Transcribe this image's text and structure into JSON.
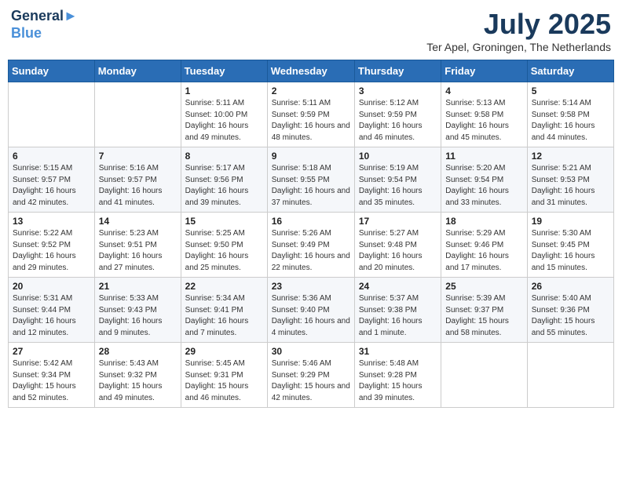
{
  "header": {
    "logo_line1": "General",
    "logo_line2": "Blue",
    "month_title": "July 2025",
    "location": "Ter Apel, Groningen, The Netherlands"
  },
  "weekdays": [
    "Sunday",
    "Monday",
    "Tuesday",
    "Wednesday",
    "Thursday",
    "Friday",
    "Saturday"
  ],
  "weeks": [
    [
      {
        "day": "",
        "detail": ""
      },
      {
        "day": "",
        "detail": ""
      },
      {
        "day": "1",
        "detail": "Sunrise: 5:11 AM\nSunset: 10:00 PM\nDaylight: 16 hours and 49 minutes."
      },
      {
        "day": "2",
        "detail": "Sunrise: 5:11 AM\nSunset: 9:59 PM\nDaylight: 16 hours and 48 minutes."
      },
      {
        "day": "3",
        "detail": "Sunrise: 5:12 AM\nSunset: 9:59 PM\nDaylight: 16 hours and 46 minutes."
      },
      {
        "day": "4",
        "detail": "Sunrise: 5:13 AM\nSunset: 9:58 PM\nDaylight: 16 hours and 45 minutes."
      },
      {
        "day": "5",
        "detail": "Sunrise: 5:14 AM\nSunset: 9:58 PM\nDaylight: 16 hours and 44 minutes."
      }
    ],
    [
      {
        "day": "6",
        "detail": "Sunrise: 5:15 AM\nSunset: 9:57 PM\nDaylight: 16 hours and 42 minutes."
      },
      {
        "day": "7",
        "detail": "Sunrise: 5:16 AM\nSunset: 9:57 PM\nDaylight: 16 hours and 41 minutes."
      },
      {
        "day": "8",
        "detail": "Sunrise: 5:17 AM\nSunset: 9:56 PM\nDaylight: 16 hours and 39 minutes."
      },
      {
        "day": "9",
        "detail": "Sunrise: 5:18 AM\nSunset: 9:55 PM\nDaylight: 16 hours and 37 minutes."
      },
      {
        "day": "10",
        "detail": "Sunrise: 5:19 AM\nSunset: 9:54 PM\nDaylight: 16 hours and 35 minutes."
      },
      {
        "day": "11",
        "detail": "Sunrise: 5:20 AM\nSunset: 9:54 PM\nDaylight: 16 hours and 33 minutes."
      },
      {
        "day": "12",
        "detail": "Sunrise: 5:21 AM\nSunset: 9:53 PM\nDaylight: 16 hours and 31 minutes."
      }
    ],
    [
      {
        "day": "13",
        "detail": "Sunrise: 5:22 AM\nSunset: 9:52 PM\nDaylight: 16 hours and 29 minutes."
      },
      {
        "day": "14",
        "detail": "Sunrise: 5:23 AM\nSunset: 9:51 PM\nDaylight: 16 hours and 27 minutes."
      },
      {
        "day": "15",
        "detail": "Sunrise: 5:25 AM\nSunset: 9:50 PM\nDaylight: 16 hours and 25 minutes."
      },
      {
        "day": "16",
        "detail": "Sunrise: 5:26 AM\nSunset: 9:49 PM\nDaylight: 16 hours and 22 minutes."
      },
      {
        "day": "17",
        "detail": "Sunrise: 5:27 AM\nSunset: 9:48 PM\nDaylight: 16 hours and 20 minutes."
      },
      {
        "day": "18",
        "detail": "Sunrise: 5:29 AM\nSunset: 9:46 PM\nDaylight: 16 hours and 17 minutes."
      },
      {
        "day": "19",
        "detail": "Sunrise: 5:30 AM\nSunset: 9:45 PM\nDaylight: 16 hours and 15 minutes."
      }
    ],
    [
      {
        "day": "20",
        "detail": "Sunrise: 5:31 AM\nSunset: 9:44 PM\nDaylight: 16 hours and 12 minutes."
      },
      {
        "day": "21",
        "detail": "Sunrise: 5:33 AM\nSunset: 9:43 PM\nDaylight: 16 hours and 9 minutes."
      },
      {
        "day": "22",
        "detail": "Sunrise: 5:34 AM\nSunset: 9:41 PM\nDaylight: 16 hours and 7 minutes."
      },
      {
        "day": "23",
        "detail": "Sunrise: 5:36 AM\nSunset: 9:40 PM\nDaylight: 16 hours and 4 minutes."
      },
      {
        "day": "24",
        "detail": "Sunrise: 5:37 AM\nSunset: 9:38 PM\nDaylight: 16 hours and 1 minute."
      },
      {
        "day": "25",
        "detail": "Sunrise: 5:39 AM\nSunset: 9:37 PM\nDaylight: 15 hours and 58 minutes."
      },
      {
        "day": "26",
        "detail": "Sunrise: 5:40 AM\nSunset: 9:36 PM\nDaylight: 15 hours and 55 minutes."
      }
    ],
    [
      {
        "day": "27",
        "detail": "Sunrise: 5:42 AM\nSunset: 9:34 PM\nDaylight: 15 hours and 52 minutes."
      },
      {
        "day": "28",
        "detail": "Sunrise: 5:43 AM\nSunset: 9:32 PM\nDaylight: 15 hours and 49 minutes."
      },
      {
        "day": "29",
        "detail": "Sunrise: 5:45 AM\nSunset: 9:31 PM\nDaylight: 15 hours and 46 minutes."
      },
      {
        "day": "30",
        "detail": "Sunrise: 5:46 AM\nSunset: 9:29 PM\nDaylight: 15 hours and 42 minutes."
      },
      {
        "day": "31",
        "detail": "Sunrise: 5:48 AM\nSunset: 9:28 PM\nDaylight: 15 hours and 39 minutes."
      },
      {
        "day": "",
        "detail": ""
      },
      {
        "day": "",
        "detail": ""
      }
    ]
  ]
}
